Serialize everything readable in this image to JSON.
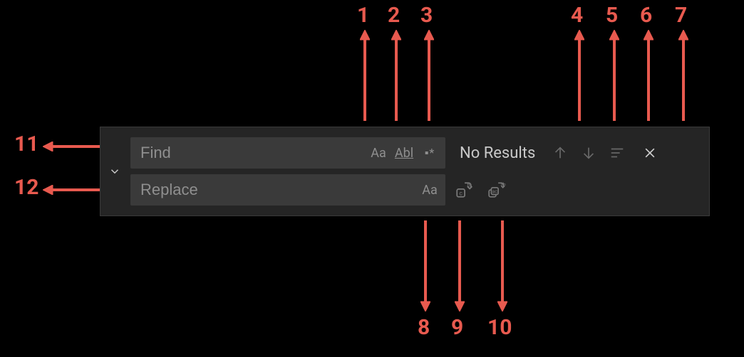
{
  "find": {
    "placeholder": "Find",
    "value": "",
    "match_case_label": "Aa",
    "whole_word_label": "Abl",
    "regex_label": ".*"
  },
  "replace": {
    "placeholder": "Replace",
    "value": "",
    "preserve_case_label": "Aa"
  },
  "status": "No Results",
  "annotations": {
    "n1": "1",
    "n2": "2",
    "n3": "3",
    "n4": "4",
    "n5": "5",
    "n6": "6",
    "n7": "7",
    "n8": "8",
    "n9": "9",
    "n10": "10",
    "n11": "11",
    "n12": "12"
  }
}
